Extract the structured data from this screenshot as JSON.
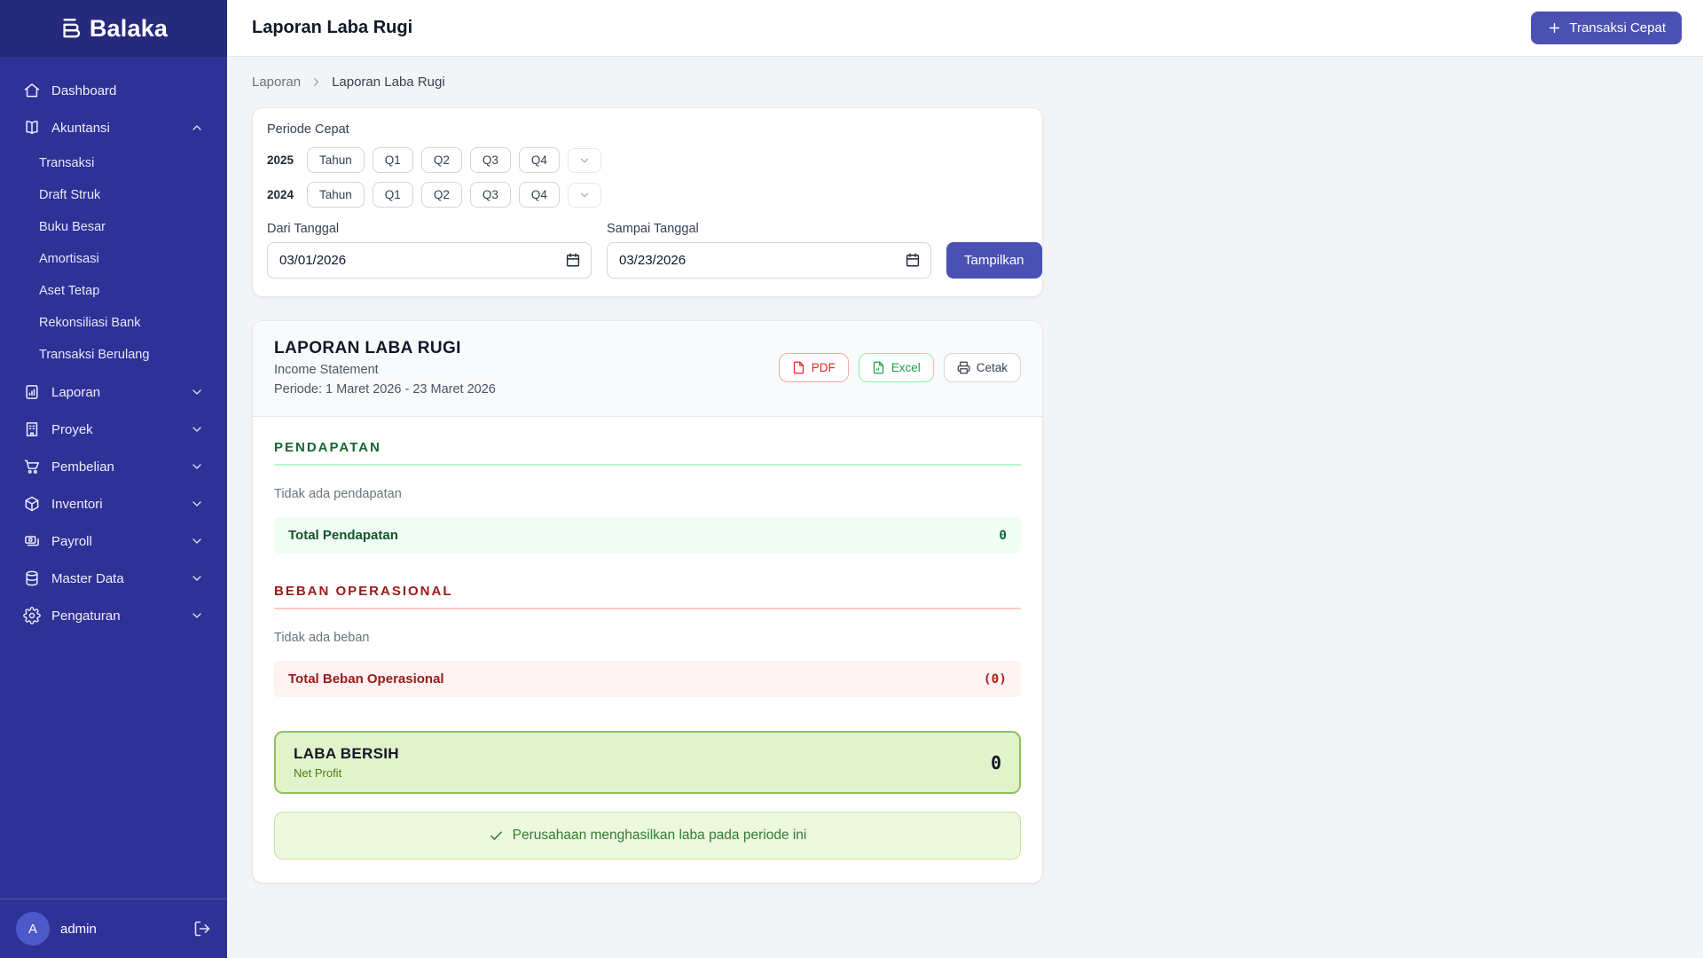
{
  "app": {
    "name": "Balaka"
  },
  "colors": {
    "sidebar_bg": "#2e3196",
    "sidebar_band_bg": "#252a7d",
    "accent_indigo": "#4a51b2",
    "income_green": "#166534",
    "expense_red": "#991b1b",
    "net_box_bg": "#e2f3cb",
    "net_box_border": "#8fc25c",
    "pdf_red": "#dc2626",
    "excel_green": "#16a34a"
  },
  "sidebar": {
    "items": [
      {
        "label": "Dashboard",
        "icon": "home"
      },
      {
        "label": "Akuntansi",
        "icon": "book-open",
        "expanded": true,
        "children": [
          "Transaksi",
          "Draft Struk",
          "Buku Besar",
          "Amortisasi",
          "Aset Tetap",
          "Rekonsiliasi Bank",
          "Transaksi Berulang"
        ]
      },
      {
        "label": "Laporan",
        "icon": "report-chart"
      },
      {
        "label": "Proyek",
        "icon": "building"
      },
      {
        "label": "Pembelian",
        "icon": "shopping-cart"
      },
      {
        "label": "Inventori",
        "icon": "cube"
      },
      {
        "label": "Payroll",
        "icon": "banknotes"
      },
      {
        "label": "Master Data",
        "icon": "database"
      },
      {
        "label": "Pengaturan",
        "icon": "gear"
      }
    ],
    "user": {
      "initial": "A",
      "name": "admin"
    }
  },
  "header": {
    "title": "Laporan Laba Rugi",
    "quick_action": "Transaksi Cepat"
  },
  "breadcrumb": {
    "parent": "Laporan",
    "current": "Laporan Laba Rugi"
  },
  "filter": {
    "title": "Periode Cepat",
    "years": [
      {
        "year": "2025",
        "buttons": [
          "Tahun",
          "Q1",
          "Q2",
          "Q3",
          "Q4"
        ]
      },
      {
        "year": "2024",
        "buttons": [
          "Tahun",
          "Q1",
          "Q2",
          "Q3",
          "Q4"
        ]
      }
    ],
    "from_label": "Dari Tanggal",
    "from_value": "03/01/2026",
    "to_label": "Sampai Tanggal",
    "to_value": "03/23/2026",
    "submit_label": "Tampilkan"
  },
  "report": {
    "title": "LAPORAN LABA RUGI",
    "subtitle": "Income Statement",
    "period": "Periode: 1 Maret 2026 - 23 Maret 2026",
    "actions": {
      "pdf": "PDF",
      "excel": "Excel",
      "print": "Cetak"
    },
    "sections": {
      "income": {
        "heading": "PENDAPATAN",
        "empty": "Tidak ada pendapatan",
        "total_label": "Total Pendapatan",
        "total_value": "0"
      },
      "expense": {
        "heading": "BEBAN OPERASIONAL",
        "empty": "Tidak ada beban",
        "total_label": "Total Beban Operasional",
        "total_value": "(0)"
      }
    },
    "net": {
      "title": "LABA BERSIH",
      "subtitle": "Net Profit",
      "value": "0"
    },
    "message": {
      "text": "Perusahaan menghasilkan laba pada periode ini"
    }
  }
}
